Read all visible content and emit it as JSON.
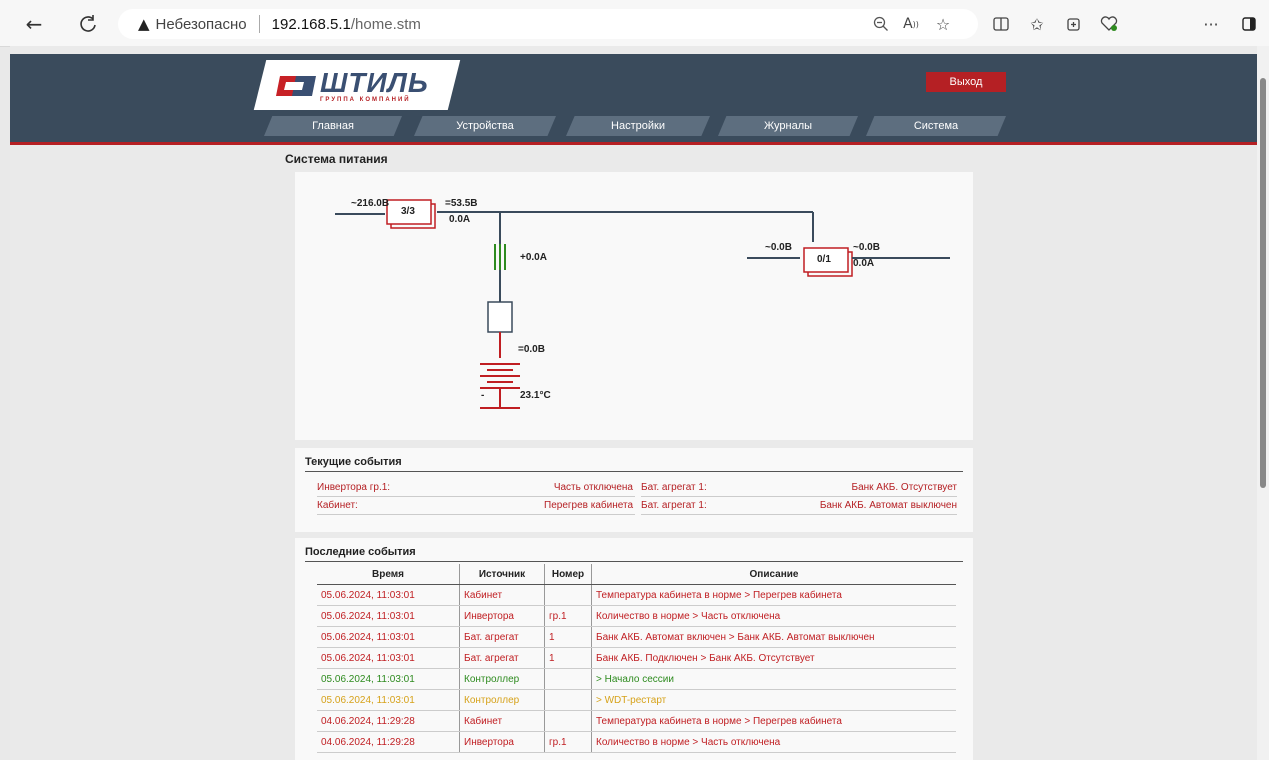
{
  "browser": {
    "back": "←",
    "refresh": "C",
    "warning_icon": "▲",
    "insecure_label": "Небезопасно",
    "url_host": "192.168.5.1",
    "url_path": "/home.stm"
  },
  "header": {
    "logo_name": "ШТИЛЬ",
    "logo_sub": "ГРУППА КОМПАНИЙ",
    "exit_label": "Выход",
    "nav": [
      "Главная",
      "Устройства",
      "Настройки",
      "Журналы",
      "Система"
    ]
  },
  "section_title": "Система питания",
  "diagram": {
    "input_voltage": "~216.0В",
    "rectifier_count": "3/3",
    "output_voltage": "=53.5В",
    "output_current": "0.0A",
    "battery_current": "+0.0A",
    "battery_voltage": "=0.0В",
    "battery_temp": "23.1°С",
    "battery_minus": "-",
    "inv_in_voltage": "~0.0В",
    "inverter_count": "0/1",
    "inv_out_voltage": "~0.0В",
    "inv_out_current": "0.0A"
  },
  "current_events": {
    "title": "Текущие события",
    "rows": [
      {
        "source": "Инвертора гр.1:",
        "value": "Часть отключена",
        "source2": "Бат. агрегат 1:",
        "value2": "Банк АКБ. Отсутствует"
      },
      {
        "source": "Кабинет:",
        "value": "Перегрев кабинета",
        "source2": "Бат. агрегат 1:",
        "value2": "Банк АКБ. Автомат выключен"
      }
    ]
  },
  "last_events": {
    "title": "Последние события",
    "headers": [
      "Время",
      "Источник",
      "Номер",
      "Описание"
    ],
    "rows": [
      {
        "time": "05.06.2024, 11:03:01",
        "source": "Кабинет",
        "num": "",
        "desc": "Температура кабинета в норме > Перегрев кабинета",
        "color": "red"
      },
      {
        "time": "05.06.2024, 11:03:01",
        "source": "Инвертора",
        "num": "гр.1",
        "desc": "Количество в норме > Часть отключена",
        "color": "red"
      },
      {
        "time": "05.06.2024, 11:03:01",
        "source": "Бат. агрегат",
        "num": "1",
        "desc": "Банк АКБ. Автомат включен > Банк АКБ. Автомат выключен",
        "color": "red"
      },
      {
        "time": "05.06.2024, 11:03:01",
        "source": "Бат. агрегат",
        "num": "1",
        "desc": "Банк АКБ. Подключен > Банк АКБ. Отсутствует",
        "color": "red"
      },
      {
        "time": "05.06.2024, 11:03:01",
        "source": "Контроллер",
        "num": "",
        "desc": "> Начало сессии",
        "color": "green"
      },
      {
        "time": "05.06.2024, 11:03:01",
        "source": "Контроллер",
        "num": "",
        "desc": "> WDT-рестарт",
        "color": "yellow"
      },
      {
        "time": "04.06.2024, 11:29:28",
        "source": "Кабинет",
        "num": "",
        "desc": "Температура кабинета в норме > Перегрев кабинета",
        "color": "red"
      },
      {
        "time": "04.06.2024, 11:29:28",
        "source": "Инвертора",
        "num": "гр.1",
        "desc": "Количество в норме > Часть отключена",
        "color": "red"
      }
    ]
  },
  "icons": {
    "back": "back-arrow-icon",
    "refresh": "refresh-icon",
    "warning": "warning-icon",
    "zoom": "zoom-out-icon",
    "read_aloud": "read-aloud-icon",
    "favorite": "star-icon",
    "split": "split-screen-icon",
    "favorites_bar": "favorites-icon",
    "collections": "collections-icon",
    "health": "browser-essentials-icon",
    "more": "more-icon",
    "sidebar": "sidebar-icon"
  },
  "colors": {
    "banner": "#3a4b5c",
    "accent_red": "#b52024",
    "ok_green": "#2e8b1f",
    "warn_yellow": "#d6a21a"
  }
}
